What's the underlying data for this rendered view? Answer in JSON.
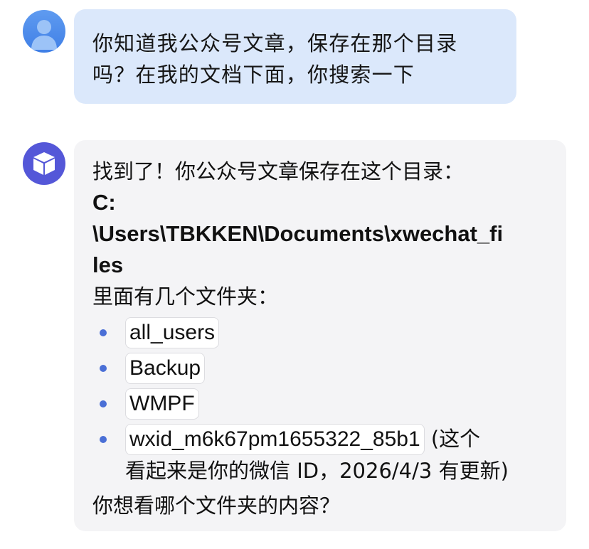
{
  "user_message": {
    "text": "你知道我公众号文章，保存在那个目录吗？在我的文档下面，你搜索一下"
  },
  "bot_message": {
    "intro": "找到了！你公众号文章保存在这个目录：",
    "path_line1": "C:",
    "path_line2": "\\Users\\TBKKEN\\Documents\\xwechat_fi",
    "path_line3": "les",
    "folders_intro": "里面有几个文件夹：",
    "folders": [
      {
        "name": "all_users"
      },
      {
        "name": "Backup"
      },
      {
        "name": "WMPF"
      },
      {
        "name": "wxid_m6k67pm1655322_85b1"
      }
    ],
    "note_part1": " (这个",
    "note_part2": "看起来是你的微信 ID，2026/4/3 有更新)",
    "question": "你想看哪个文件夹的内容？"
  },
  "colors": {
    "user_bubble": "#dbe8fb",
    "bot_bubble": "#f4f4f6",
    "user_avatar": "#3f7fe6",
    "bot_avatar": "#5457d8",
    "bullet": "#4a6fd6"
  },
  "icons": {
    "user_avatar": "person-icon",
    "bot_avatar": "cube-icon"
  }
}
